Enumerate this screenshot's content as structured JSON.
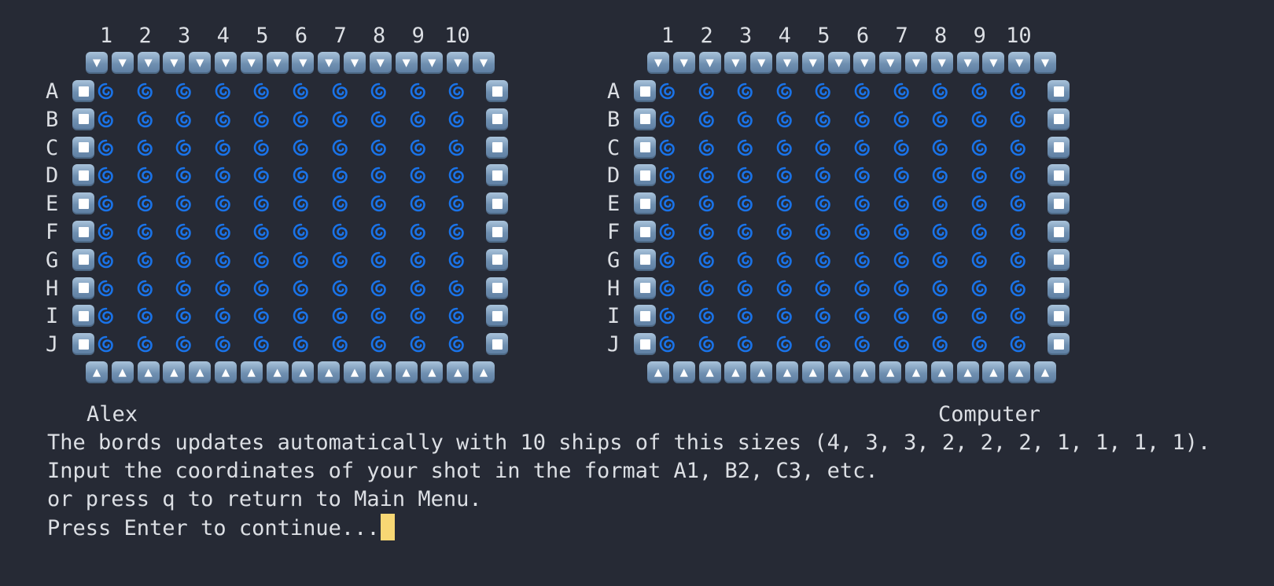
{
  "columns": [
    "1",
    "2",
    "3",
    "4",
    "5",
    "6",
    "7",
    "8",
    "9",
    "10"
  ],
  "rows": [
    "A",
    "B",
    "C",
    "D",
    "E",
    "F",
    "G",
    "H",
    "I",
    "J"
  ],
  "boards": [
    {
      "player": "Alex",
      "cell_icon": "water-cyclone-icon"
    },
    {
      "player": "Computer",
      "cell_icon": "water-cyclone-icon"
    }
  ],
  "border_icons": {
    "top": "down-arrow-button-icon",
    "bottom": "up-arrow-button-icon",
    "side": "white-square-button-icon"
  },
  "messages": [
    "The bords updates automatically with 10 ships of this sizes (4, 3, 3, 2, 2, 2, 1, 1, 1, 1).",
    "Input the coordinates of your shot in the format A1, B2, C3, etc.",
    "or press q to return to Main Menu.",
    "Press Enter to continue..."
  ],
  "colors": {
    "background": "#262a35",
    "text": "#dcdfe4",
    "cyclone": "#1a73e8",
    "tile": "#7a9abb",
    "cursor": "#f7d774"
  }
}
